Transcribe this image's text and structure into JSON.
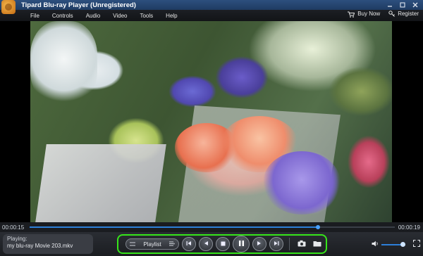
{
  "window": {
    "title": "Tipard Blu-ray Player (Unregistered)",
    "controls": [
      "minimize-icon",
      "maximize-icon",
      "close-icon"
    ]
  },
  "menu": {
    "items": [
      "File",
      "Controls",
      "Audio",
      "Video",
      "Tools",
      "Help"
    ],
    "buy_now": "Buy Now",
    "register": "Register"
  },
  "progress": {
    "current": "00:00:15",
    "total": "00:00:19",
    "fraction": 0.79
  },
  "now_playing": {
    "label": "Playing:",
    "file": "my blu-ray Movie 203.mkv"
  },
  "controls": {
    "playlist_label": "Playlist",
    "buttons": [
      "previous-chapter-icon",
      "rewind-icon",
      "stop-icon",
      "pause-icon",
      "fast-forward-icon",
      "next-chapter-icon",
      "snapshot-icon",
      "open-folder-icon"
    ]
  },
  "volume": {
    "level": 1.0
  },
  "colors": {
    "accent": "#2d7fd8",
    "highlight_border": "#36e51a"
  }
}
